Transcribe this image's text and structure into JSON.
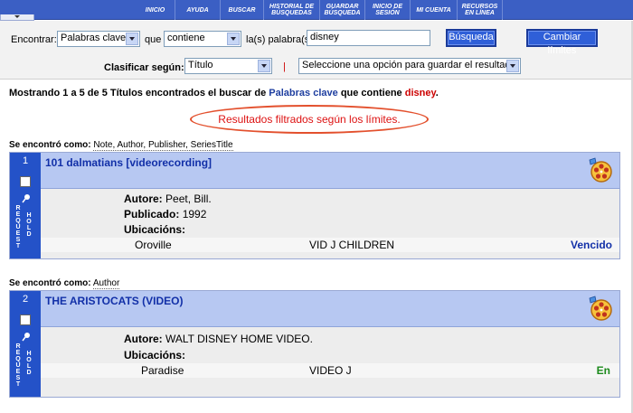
{
  "nav": {
    "items": [
      {
        "label": "INICIO"
      },
      {
        "label": "AYUDA"
      },
      {
        "label": "BUSCAR"
      },
      {
        "label": "HISTORIAL DE BÚSQUEDAS"
      },
      {
        "label": "GUARDAR BÚSQUEDA"
      },
      {
        "label": "INICIO DE SESIÓN"
      },
      {
        "label": "MI CUENTA"
      },
      {
        "label": "RECURSOS EN LÍNEA"
      }
    ]
  },
  "search": {
    "find_label": "Encontrar:",
    "field_select": "Palabras clave",
    "que_label": "que",
    "operator_select": "contiene",
    "words_label": "la(s) palabra(s)",
    "query_value": "disney",
    "search_button": "Búsqueda",
    "limits_button": "Cambiar límites",
    "sort_label": "Clasificar según:",
    "sort_select": "Título",
    "separator": "|",
    "save_select": "Seleccione una opción para guardar el resultado"
  },
  "results": {
    "summary_prefix": "Mostrando 1 a 5 de 5 Títulos encontrados el buscar de",
    "summary_field": "Palabras clave",
    "summary_mid": "que contiene",
    "summary_term": "disney",
    "summary_end": ".",
    "filter_note": "Resultados filtrados según los límites."
  },
  "records": [
    {
      "found_label": "Se encontró como:",
      "found_fields": "Note, Author, Publisher, SeriesTitle",
      "number": "1",
      "title": "101 dalmatians [videorecording]",
      "author_label": "Autore:",
      "author": "Peet, Bill.",
      "published_label": "Publicado:",
      "published": "1992",
      "locations_label": "Ubicacións:",
      "location": "Oroville",
      "call_number": "VID J CHILDREN",
      "status": "Vencido"
    },
    {
      "found_label": "Se encontró como:",
      "found_fields": "Author",
      "number": "2",
      "title": "THE ARISTOCATS (VIDEO)",
      "author_label": "Autore:",
      "author": "WALT DISNEY HOME VIDEO.",
      "locations_label": "Ubicacións:",
      "location": "Paradise",
      "call_number": "VIDEO J",
      "status": "En"
    }
  ],
  "request_hold": {
    "request": "REQUEST",
    "hold": "HOLD"
  },
  "colors": {
    "nav_bg": "#3b5fc4",
    "side_bg": "#2452c8",
    "title_bg": "#b7c8f2",
    "filter_ellipse": "#e3502d",
    "status_overdue": "#1230a8",
    "status_in": "#1c8a1c"
  }
}
